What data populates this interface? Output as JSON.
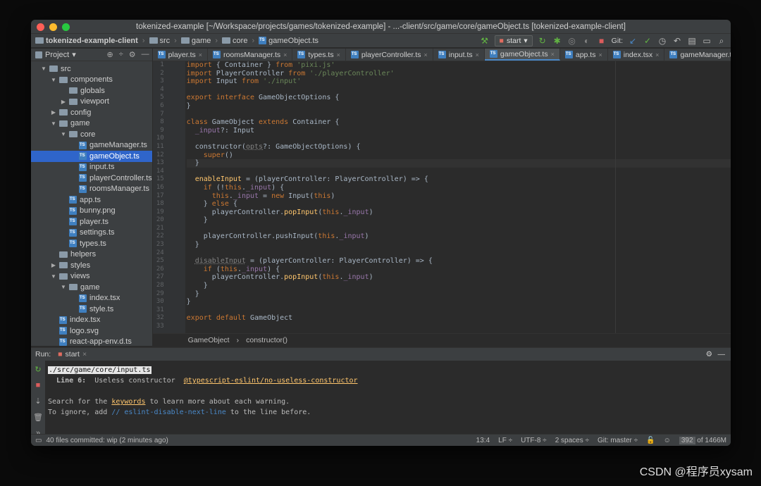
{
  "window": {
    "title": "tokenized-example [~/Workspace/projects/games/tokenized-example] - ...-client/src/game/core/gameObject.ts [tokenized-example-client]",
    "colors": {
      "red": "#ff5f57",
      "yellow": "#febc2e",
      "green": "#28c840"
    }
  },
  "nav": {
    "crumbs": [
      "tokenized-example-client",
      "src",
      "game",
      "core",
      "gameObject.ts"
    ],
    "run_config": "start",
    "git_label": "Git:"
  },
  "sidebar": {
    "title": "Project",
    "tree": [
      {
        "label": "src",
        "depth": 0,
        "type": "folder",
        "open": true
      },
      {
        "label": "components",
        "depth": 1,
        "type": "folder",
        "open": true
      },
      {
        "label": "globals",
        "depth": 2,
        "type": "folder",
        "open": null
      },
      {
        "label": "viewport",
        "depth": 2,
        "type": "folder",
        "open": false
      },
      {
        "label": "config",
        "depth": 1,
        "type": "folder",
        "open": false
      },
      {
        "label": "game",
        "depth": 1,
        "type": "folder",
        "open": true
      },
      {
        "label": "core",
        "depth": 2,
        "type": "folder",
        "open": true
      },
      {
        "label": "gameManager.ts",
        "depth": 3,
        "type": "file"
      },
      {
        "label": "gameObject.ts",
        "depth": 3,
        "type": "file",
        "selected": true
      },
      {
        "label": "input.ts",
        "depth": 3,
        "type": "file"
      },
      {
        "label": "playerController.ts",
        "depth": 3,
        "type": "file"
      },
      {
        "label": "roomsManager.ts",
        "depth": 3,
        "type": "file"
      },
      {
        "label": "app.ts",
        "depth": 2,
        "type": "file"
      },
      {
        "label": "bunny.png",
        "depth": 2,
        "type": "file"
      },
      {
        "label": "player.ts",
        "depth": 2,
        "type": "file"
      },
      {
        "label": "settings.ts",
        "depth": 2,
        "type": "file"
      },
      {
        "label": "types.ts",
        "depth": 2,
        "type": "file"
      },
      {
        "label": "helpers",
        "depth": 1,
        "type": "folder",
        "open": null
      },
      {
        "label": "styles",
        "depth": 1,
        "type": "folder",
        "open": false
      },
      {
        "label": "views",
        "depth": 1,
        "type": "folder",
        "open": true
      },
      {
        "label": "game",
        "depth": 2,
        "type": "folder",
        "open": true
      },
      {
        "label": "index.tsx",
        "depth": 3,
        "type": "file"
      },
      {
        "label": "style.ts",
        "depth": 3,
        "type": "file"
      },
      {
        "label": "index.tsx",
        "depth": 1,
        "type": "file"
      },
      {
        "label": "logo.svg",
        "depth": 1,
        "type": "file"
      },
      {
        "label": "react-app-env.d.ts",
        "depth": 1,
        "type": "file"
      }
    ]
  },
  "tabs": [
    {
      "label": "player.ts",
      "active": false
    },
    {
      "label": "roomsManager.ts",
      "active": false
    },
    {
      "label": "types.ts",
      "active": false
    },
    {
      "label": "playerController.ts",
      "active": false
    },
    {
      "label": "input.ts",
      "active": false
    },
    {
      "label": "gameObject.ts",
      "active": true
    },
    {
      "label": "app.ts",
      "active": false
    },
    {
      "label": "index.tsx",
      "active": false
    },
    {
      "label": "gameManager.ts",
      "active": false
    }
  ],
  "code": [
    "import { Container } from 'pixi.js'",
    "import PlayerController from './playerController'",
    "import Input from './input'",
    "",
    "export interface GameObjectOptions {",
    "}",
    "",
    "class GameObject extends Container {",
    "  _input?: Input",
    "",
    "  constructor(opts?: GameObjectOptions) {",
    "    super()",
    "  }",
    "",
    "  enableInput = (playerController: PlayerController) => {",
    "    if (!this._input) {",
    "      this._input = new Input(this)",
    "    } else {",
    "      playerController.popInput(this._input)",
    "    }",
    "",
    "    playerController.pushInput(this._input)",
    "  }",
    "",
    "  disableInput = (playerController: PlayerController) => {",
    "    if (this._input) {",
    "      playerController.popInput(this._input)",
    "    }",
    "  }",
    "}",
    "",
    "export default GameObject",
    ""
  ],
  "current_line": 13,
  "editor_breadcrumb": [
    "GameObject",
    "constructor()"
  ],
  "run": {
    "label": "Run:",
    "config": "start",
    "console": {
      "path": "./src/game/core/input.ts",
      "line_label": "Line 6:",
      "message": "Useless constructor",
      "rule": "@typescript-eslint/no-useless-constructor",
      "search_pre": "Search for the ",
      "search_link": "keywords",
      "search_post": " to learn more about each warning.",
      "ignore_pre": "To ignore, add ",
      "ignore_code": "// eslint-disable-next-line",
      "ignore_post": " to the line before."
    }
  },
  "status": {
    "message": "40 files committed: wip (2 minutes ago)",
    "position": "13:4",
    "line_sep": "LF ÷",
    "encoding": "UTF-8 ÷",
    "indent": "2 spaces ÷",
    "git": "Git: master ÷",
    "memory_used": "392",
    "memory_total": "of 1466M"
  },
  "watermark": "CSDN @程序员xysam"
}
